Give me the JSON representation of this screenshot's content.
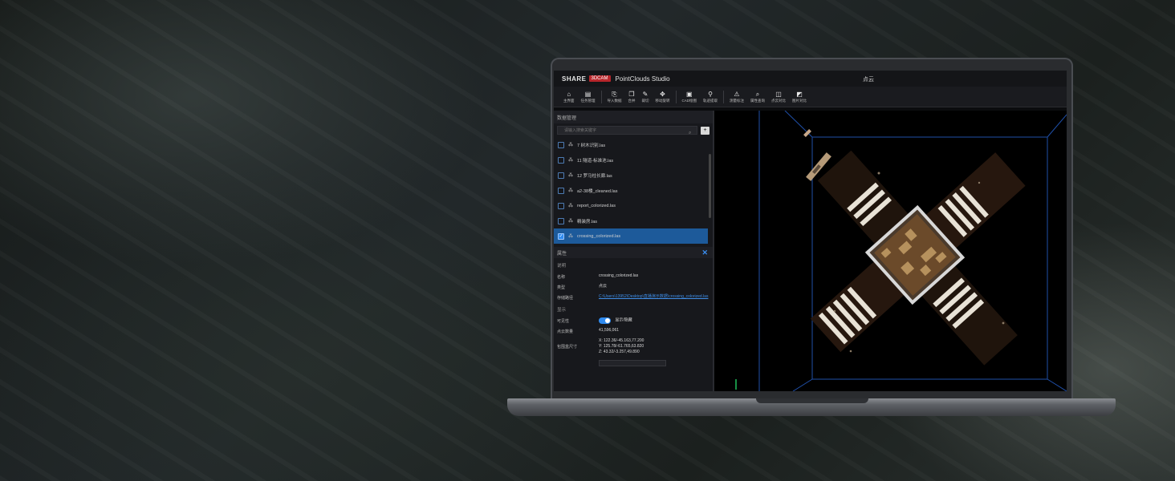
{
  "app": {
    "logo_text": "SHARE",
    "logo_badge": "3DCAM",
    "name": "PointClouds Studio",
    "window_title": "点云"
  },
  "toolbar": {
    "items": [
      {
        "label": "主界面",
        "icon": "home-icon"
      },
      {
        "label": "任务管理",
        "icon": "task-icon"
      },
      {
        "label": "导入数据",
        "icon": "import-icon"
      },
      {
        "label": "合并",
        "icon": "merge-icon"
      },
      {
        "label": "裁切",
        "icon": "crop-icon"
      },
      {
        "label": "移动旋转",
        "icon": "move-icon"
      },
      {
        "label": "CAD绘图",
        "icon": "cad-icon"
      },
      {
        "label": "轨迹提取",
        "icon": "trajectory-icon"
      },
      {
        "label": "测量标注",
        "icon": "measure-icon"
      },
      {
        "label": "属性查询",
        "icon": "query-icon"
      },
      {
        "label": "点云对比",
        "icon": "compare-icon"
      },
      {
        "label": "图片对比",
        "icon": "image-compare-icon"
      }
    ]
  },
  "data_panel": {
    "title": "数据管理",
    "search_placeholder": "请输入搜索关键字",
    "files": [
      {
        "name": "7 树木识别.las",
        "checked": false
      },
      {
        "name": "11 隧道-标准池.las",
        "checked": false
      },
      {
        "name": "12 罗马柱长廊.las",
        "checked": false
      },
      {
        "name": "a2-38楼_cleaned.las",
        "checked": false
      },
      {
        "name": "report_colorized.las",
        "checked": false
      },
      {
        "name": "精装房.las",
        "checked": false
      },
      {
        "name": "crossing_colorized.las",
        "checked": true
      }
    ]
  },
  "properties": {
    "title": "属性",
    "section_desc": "说明",
    "name_key": "名称",
    "name_val": "crossing_colorized.las",
    "type_key": "类型",
    "type_val": "点云",
    "path_key": "存储路径",
    "path_val": "C:\\Users\\13952\\Desktop\\直播演示数据\\crossing_colorized.las",
    "section_display": "显示",
    "visible_key": "可见性",
    "visible_val": "显示/隐藏",
    "count_key": "点云数量",
    "count_val": "41,596,061",
    "bbox_key": "包围盒尺寸",
    "bbox_x": "X: 122.36/-45.163,77.200",
    "bbox_y": "Y: 125.78/-61.765,63.820",
    "bbox_z": "Z: 43.32/-3.257,49.890"
  },
  "colors": {
    "accent": "#2f8bf0",
    "selected_row": "#1d5a9a",
    "brand_red": "#b8262b",
    "bbox_line": "#1f4fa8"
  }
}
